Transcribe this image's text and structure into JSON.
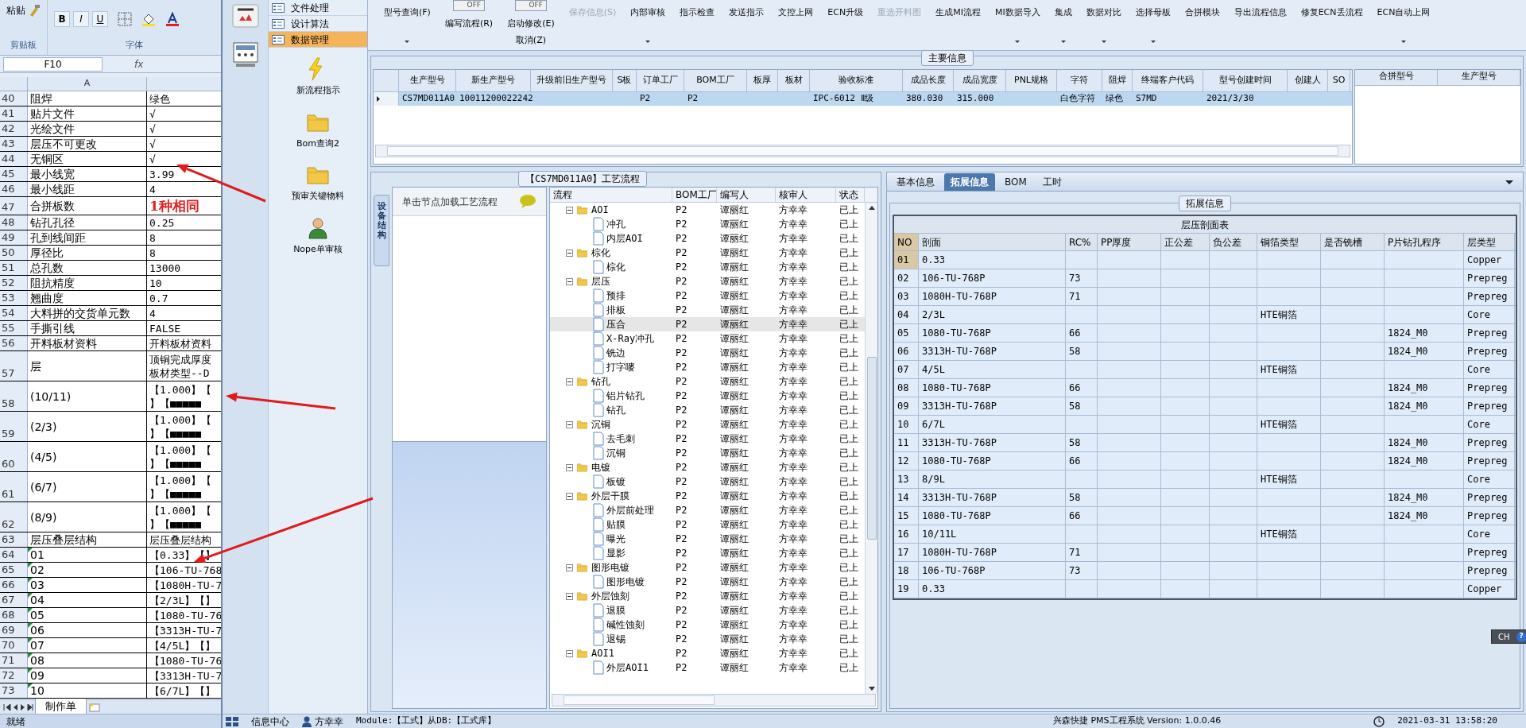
{
  "excel": {
    "ribbon": {
      "paste": "粘贴",
      "clipboard_group": "剪贴板",
      "font_group": "字体",
      "bold": "B",
      "italic": "I",
      "underline": "U"
    },
    "name_box": "F10",
    "fx": "fx",
    "column_a": "A",
    "rows": [
      {
        "row": "40",
        "a": "阻焊",
        "b": [
          "绿色"
        ],
        "kind": "normal"
      },
      {
        "row": "41",
        "a": "贴片文件",
        "b": [
          "√"
        ],
        "kind": "normal"
      },
      {
        "row": "42",
        "a": "光绘文件",
        "b": [
          "√"
        ],
        "kind": "normal"
      },
      {
        "row": "43",
        "a": "层压不可更改",
        "b": [
          "√"
        ],
        "kind": "normal"
      },
      {
        "row": "44",
        "a": "无铜区",
        "b": [
          "√"
        ],
        "kind": "normal"
      },
      {
        "row": "45",
        "a": "最小线宽",
        "b": [
          "3.99"
        ],
        "kind": "normal"
      },
      {
        "row": "46",
        "a": "最小线距",
        "b": [
          "4"
        ],
        "kind": "normal"
      },
      {
        "row": "47",
        "a": "合拼板数",
        "b": [
          "1种相同"
        ],
        "kind": "emphasis"
      },
      {
        "row": "48",
        "a": "钻孔孔径",
        "b": [
          "0.25"
        ],
        "kind": "normal"
      },
      {
        "row": "49",
        "a": "孔到线间距",
        "b": [
          "8"
        ],
        "kind": "normal"
      },
      {
        "row": "50",
        "a": "厚径比",
        "b": [
          "8"
        ],
        "kind": "normal"
      },
      {
        "row": "51",
        "a": "总孔数",
        "b": [
          "13000"
        ],
        "kind": "normal"
      },
      {
        "row": "52",
        "a": "阻抗精度",
        "b": [
          "10"
        ],
        "kind": "normal"
      },
      {
        "row": "53",
        "a": "翘曲度",
        "b": [
          "0.7"
        ],
        "kind": "normal"
      },
      {
        "row": "54",
        "a": "大料拼的交货单元数",
        "b": [
          "4"
        ],
        "kind": "normal"
      },
      {
        "row": "55",
        "a": "手撕引线",
        "b": [
          "FALSE"
        ],
        "kind": "normal"
      },
      {
        "row": "56",
        "a": "开料板材资料",
        "b": [
          "开料板材资料"
        ],
        "kind": "normal"
      },
      {
        "row": "57",
        "a": "层",
        "b": [
          "顶铜完成厚度",
          "板材类型--D"
        ],
        "kind": "double"
      },
      {
        "row": "58",
        "a": "(10/11)",
        "b": [
          "【1.000】【",
          "】【■■■■■"
        ],
        "kind": "double"
      },
      {
        "row": "59",
        "a": "(2/3)",
        "b": [
          "【1.000】【",
          "】【■■■■■"
        ],
        "kind": "double"
      },
      {
        "row": "60",
        "a": "(4/5)",
        "b": [
          "【1.000】【",
          "】【■■■■■"
        ],
        "kind": "double"
      },
      {
        "row": "61",
        "a": "(6/7)",
        "b": [
          "【1.000】【",
          "】【■■■■■"
        ],
        "kind": "double"
      },
      {
        "row": "62",
        "a": "(8/9)",
        "b": [
          "【1.000】【",
          "】【■■■■■"
        ],
        "kind": "double"
      },
      {
        "row": "63",
        "a": "层压叠层结构",
        "b": [
          "层压叠层结构"
        ],
        "kind": "normal"
      },
      {
        "row": "64",
        "a": "01",
        "b": [
          "【0.33】【】"
        ],
        "kind": "flagged"
      },
      {
        "row": "65",
        "a": "02",
        "b": [
          "【106-TU-768"
        ],
        "kind": "flagged"
      },
      {
        "row": "66",
        "a": "03",
        "b": [
          "【1080H-TU-7"
        ],
        "kind": "flagged"
      },
      {
        "row": "67",
        "a": "04",
        "b": [
          "【2/3L】【】"
        ],
        "kind": "flagged"
      },
      {
        "row": "68",
        "a": "05",
        "b": [
          "【1080-TU-76"
        ],
        "kind": "flagged"
      },
      {
        "row": "69",
        "a": "06",
        "b": [
          "【3313H-TU-7"
        ],
        "kind": "flagged"
      },
      {
        "row": "70",
        "a": "07",
        "b": [
          "【4/5L】【】"
        ],
        "kind": "flagged"
      },
      {
        "row": "71",
        "a": "08",
        "b": [
          "【1080-TU-76"
        ],
        "kind": "flagged"
      },
      {
        "row": "72",
        "a": "09",
        "b": [
          "【3313H-TU-7"
        ],
        "kind": "flagged"
      },
      {
        "row": "73",
        "a": "10",
        "b": [
          "【6/7L】【】"
        ],
        "kind": "flagged"
      }
    ],
    "sheet_tabs": [
      {
        "label": "制作单",
        "selected": true
      }
    ],
    "status": "就绪"
  },
  "nav": {
    "items": [
      {
        "label": "文件处理",
        "selected": false
      },
      {
        "label": "设计算法",
        "selected": false
      },
      {
        "label": "数据管理",
        "selected": true
      }
    ],
    "tools": [
      {
        "label": "新流程指示",
        "kind": "lightning"
      },
      {
        "label": "Bom查询2",
        "kind": "folder"
      },
      {
        "label": "预审关键物料",
        "kind": "folder"
      },
      {
        "label": "Nope单审核",
        "kind": "person"
      }
    ]
  },
  "toolbar": [
    {
      "kind": "button",
      "label": "型号查询(F)",
      "dropdown": true,
      "disabled": false
    },
    {
      "kind": "toggle",
      "switch": "OFF",
      "on": false,
      "label": "编写流程(R)"
    },
    {
      "kind": "toggle",
      "switch": "OFF",
      "on": false,
      "label": "启动修改(E)",
      "sub_label": "取消(Z)"
    },
    {
      "kind": "button",
      "label": "保存信息(S)",
      "dropdown": false,
      "disabled": true
    },
    {
      "kind": "button",
      "label": "内部审核",
      "dropdown": true,
      "disabled": false
    },
    {
      "kind": "button",
      "label": "指示检查",
      "dropdown": false,
      "disabled": false
    },
    {
      "kind": "button",
      "label": "发送指示",
      "dropdown": false,
      "disabled": false
    },
    {
      "kind": "button",
      "label": "文控上网",
      "dropdown": false,
      "disabled": false
    },
    {
      "kind": "button",
      "label": "ECN升级",
      "dropdown": false,
      "disabled": false
    },
    {
      "kind": "button",
      "label": "重选开料图",
      "dropdown": false,
      "disabled": true
    },
    {
      "kind": "button",
      "label": "生成MI流程",
      "dropdown": false,
      "disabled": false
    },
    {
      "kind": "button",
      "label": "MI数据导入",
      "dropdown": true,
      "disabled": false
    },
    {
      "kind": "button",
      "label": "集成",
      "dropdown": true,
      "disabled": false
    },
    {
      "kind": "button",
      "label": "数据对比",
      "dropdown": true,
      "disabled": false
    },
    {
      "kind": "button",
      "label": "选择母板",
      "dropdown": true,
      "disabled": false
    },
    {
      "kind": "button",
      "label": "合拼模块",
      "dropdown": false,
      "disabled": false
    },
    {
      "kind": "button",
      "label": "导出流程信息",
      "dropdown": false,
      "disabled": false
    },
    {
      "kind": "button",
      "label": "修复ECN丢流程",
      "dropdown": false,
      "disabled": false
    },
    {
      "kind": "button",
      "label": "ECN自动上网",
      "dropdown": true,
      "disabled": false
    }
  ],
  "main_info": {
    "title": "主要信息",
    "columns": [
      "生产型号",
      "新生产型号",
      "升级前旧生产型号",
      "S板",
      "订单工厂",
      "BOM工厂",
      "板厚",
      "板材",
      "验收标准",
      "成品长度",
      "成品宽度",
      "PNL规格",
      "字符",
      "阻焊",
      "终端客户代码",
      "型号创建时间",
      "创建人",
      "SO"
    ],
    "rows": [
      {
        "selected": true,
        "cells": [
          "CS7MD011A0",
          "10011200022242",
          "",
          "",
          "P2",
          "P2",
          "",
          "",
          "IPC-6012 Ⅱ级",
          "380.030",
          "315.000",
          "",
          "白色字符",
          "绿色",
          "S7MD",
          "2021/3/30",
          "",
          ""
        ]
      }
    ],
    "side_columns": [
      "合拼型号",
      "生产型号"
    ]
  },
  "process": {
    "title": "【CS7MD011A0】工艺流程",
    "side_tab": "设备结构",
    "hint": "单击节点加载工艺流程",
    "columns": [
      "流程",
      "BOM工厂",
      "编写人",
      "核审人",
      "状态"
    ],
    "tree": [
      {
        "name": "AOI",
        "bom": "P2",
        "writer": "谭丽红",
        "reviewer": "方幸幸",
        "status": "已上",
        "expanded": true,
        "selected": false,
        "children": [
          {
            "name": "冲孔",
            "bom": "P2",
            "writer": "谭丽红",
            "reviewer": "方幸幸",
            "status": "已上",
            "selected": false
          },
          {
            "name": "内层AOI",
            "bom": "P2",
            "writer": "谭丽红",
            "reviewer": "方幸幸",
            "status": "已上",
            "selected": false
          }
        ]
      },
      {
        "name": "棕化",
        "bom": "P2",
        "writer": "谭丽红",
        "reviewer": "方幸幸",
        "status": "已上",
        "expanded": true,
        "selected": false,
        "children": [
          {
            "name": "棕化",
            "bom": "P2",
            "writer": "谭丽红",
            "reviewer": "方幸幸",
            "status": "已上",
            "selected": false
          }
        ]
      },
      {
        "name": "层压",
        "bom": "P2",
        "writer": "谭丽红",
        "reviewer": "方幸幸",
        "status": "已上",
        "expanded": true,
        "selected": false,
        "children": [
          {
            "name": "预排",
            "bom": "P2",
            "writer": "谭丽红",
            "reviewer": "方幸幸",
            "status": "已上",
            "selected": false
          },
          {
            "name": "排板",
            "bom": "P2",
            "writer": "谭丽红",
            "reviewer": "方幸幸",
            "status": "已上",
            "selected": false
          },
          {
            "name": "压合",
            "bom": "P2",
            "writer": "谭丽红",
            "reviewer": "方幸幸",
            "status": "已上",
            "selected": true
          },
          {
            "name": "X-Ray冲孔",
            "bom": "P2",
            "writer": "谭丽红",
            "reviewer": "方幸幸",
            "status": "已上",
            "selected": false
          },
          {
            "name": "铣边",
            "bom": "P2",
            "writer": "谭丽红",
            "reviewer": "方幸幸",
            "status": "已上",
            "selected": false
          },
          {
            "name": "打字嘜",
            "bom": "P2",
            "writer": "谭丽红",
            "reviewer": "方幸幸",
            "status": "已上",
            "selected": false
          }
        ]
      },
      {
        "name": "钻孔",
        "bom": "P2",
        "writer": "谭丽红",
        "reviewer": "方幸幸",
        "status": "已上",
        "expanded": true,
        "selected": false,
        "children": [
          {
            "name": "铝片钻孔",
            "bom": "P2",
            "writer": "谭丽红",
            "reviewer": "方幸幸",
            "status": "已上",
            "selected": false
          },
          {
            "name": "钻孔",
            "bom": "P2",
            "writer": "谭丽红",
            "reviewer": "方幸幸",
            "status": "已上",
            "selected": false
          }
        ]
      },
      {
        "name": "沉铜",
        "bom": "P2",
        "writer": "谭丽红",
        "reviewer": "方幸幸",
        "status": "已上",
        "expanded": true,
        "selected": false,
        "children": [
          {
            "name": "去毛刺",
            "bom": "P2",
            "writer": "谭丽红",
            "reviewer": "方幸幸",
            "status": "已上",
            "selected": false
          },
          {
            "name": "沉铜",
            "bom": "P2",
            "writer": "谭丽红",
            "reviewer": "方幸幸",
            "status": "已上",
            "selected": false
          }
        ]
      },
      {
        "name": "电镀",
        "bom": "P2",
        "writer": "谭丽红",
        "reviewer": "方幸幸",
        "status": "已上",
        "expanded": true,
        "selected": false,
        "children": [
          {
            "name": "板镀",
            "bom": "P2",
            "writer": "谭丽红",
            "reviewer": "方幸幸",
            "status": "已上",
            "selected": false
          }
        ]
      },
      {
        "name": "外层干膜",
        "bom": "P2",
        "writer": "谭丽红",
        "reviewer": "方幸幸",
        "status": "已上",
        "expanded": true,
        "selected": false,
        "children": [
          {
            "name": "外层前处理",
            "bom": "P2",
            "writer": "谭丽红",
            "reviewer": "方幸幸",
            "status": "已上",
            "selected": false
          },
          {
            "name": "贴膜",
            "bom": "P2",
            "writer": "谭丽红",
            "reviewer": "方幸幸",
            "status": "已上",
            "selected": false
          },
          {
            "name": "曝光",
            "bom": "P2",
            "writer": "谭丽红",
            "reviewer": "方幸幸",
            "status": "已上",
            "selected": false
          },
          {
            "name": "显影",
            "bom": "P2",
            "writer": "谭丽红",
            "reviewer": "方幸幸",
            "status": "已上",
            "selected": false
          }
        ]
      },
      {
        "name": "图形电镀",
        "bom": "P2",
        "writer": "谭丽红",
        "reviewer": "方幸幸",
        "status": "已上",
        "expanded": true,
        "selected": false,
        "children": [
          {
            "name": "图形电镀",
            "bom": "P2",
            "writer": "谭丽红",
            "reviewer": "方幸幸",
            "status": "已上",
            "selected": false
          }
        ]
      },
      {
        "name": "外层蚀刻",
        "bom": "P2",
        "writer": "谭丽红",
        "reviewer": "方幸幸",
        "status": "已上",
        "expanded": true,
        "selected": false,
        "children": [
          {
            "name": "退膜",
            "bom": "P2",
            "writer": "谭丽红",
            "reviewer": "方幸幸",
            "status": "已上",
            "selected": false
          },
          {
            "name": "碱性蚀刻",
            "bom": "P2",
            "writer": "谭丽红",
            "reviewer": "方幸幸",
            "status": "已上",
            "selected": false
          },
          {
            "name": "退锡",
            "bom": "P2",
            "writer": "谭丽红",
            "reviewer": "方幸幸",
            "status": "已上",
            "selected": false
          }
        ]
      },
      {
        "name": "AOI1",
        "bom": "P2",
        "writer": "谭丽红",
        "reviewer": "方幸幸",
        "status": "已上",
        "expanded": true,
        "selected": false,
        "children": [
          {
            "name": "外层AOI1",
            "bom": "P2",
            "writer": "谭丽红",
            "reviewer": "方幸幸",
            "status": "已上",
            "selected": false
          }
        ]
      }
    ]
  },
  "detail": {
    "tabs": [
      {
        "label": "基本信息",
        "selected": false
      },
      {
        "label": "拓展信息",
        "selected": true
      },
      {
        "label": "BOM",
        "selected": false
      },
      {
        "label": "工时",
        "selected": false
      }
    ],
    "group_title": "拓展信息",
    "table_title": "层压剖面表",
    "columns": [
      "NO",
      "剖面",
      "RC%",
      "PP厚度",
      "正公差",
      "负公差",
      "铜箔类型",
      "是否铣槽",
      "P片钻孔程序",
      "层类型"
    ],
    "rows": [
      {
        "selected": true,
        "cells": [
          "01",
          "0.33",
          "",
          "",
          "",
          "",
          "",
          "",
          "",
          "Copper"
        ]
      },
      {
        "selected": false,
        "cells": [
          "02",
          "106-TU-768P",
          "73",
          "",
          "",
          "",
          "",
          "",
          "",
          "Prepreg"
        ]
      },
      {
        "selected": false,
        "cells": [
          "03",
          "1080H-TU-768P",
          "71",
          "",
          "",
          "",
          "",
          "",
          "",
          "Prepreg"
        ]
      },
      {
        "selected": false,
        "cells": [
          "04",
          "2/3L",
          "",
          "",
          "",
          "",
          "HTE铜箔",
          "",
          "",
          "Core"
        ]
      },
      {
        "selected": false,
        "cells": [
          "05",
          "1080-TU-768P",
          "66",
          "",
          "",
          "",
          "",
          "",
          "1824_M0",
          "Prepreg"
        ]
      },
      {
        "selected": false,
        "cells": [
          "06",
          "3313H-TU-768P",
          "58",
          "",
          "",
          "",
          "",
          "",
          "1824_M0",
          "Prepreg"
        ]
      },
      {
        "selected": false,
        "cells": [
          "07",
          "4/5L",
          "",
          "",
          "",
          "",
          "HTE铜箔",
          "",
          "",
          "Core"
        ]
      },
      {
        "selected": false,
        "cells": [
          "08",
          "1080-TU-768P",
          "66",
          "",
          "",
          "",
          "",
          "",
          "1824_M0",
          "Prepreg"
        ]
      },
      {
        "selected": false,
        "cells": [
          "09",
          "3313H-TU-768P",
          "58",
          "",
          "",
          "",
          "",
          "",
          "1824_M0",
          "Prepreg"
        ]
      },
      {
        "selected": false,
        "cells": [
          "10",
          "6/7L",
          "",
          "",
          "",
          "",
          "HTE铜箔",
          "",
          "",
          "Core"
        ]
      },
      {
        "selected": false,
        "cells": [
          "11",
          "3313H-TU-768P",
          "58",
          "",
          "",
          "",
          "",
          "",
          "1824_M0",
          "Prepreg"
        ]
      },
      {
        "selected": false,
        "cells": [
          "12",
          "1080-TU-768P",
          "66",
          "",
          "",
          "",
          "",
          "",
          "1824_M0",
          "Prepreg"
        ]
      },
      {
        "selected": false,
        "cells": [
          "13",
          "8/9L",
          "",
          "",
          "",
          "",
          "HTE铜箔",
          "",
          "",
          "Core"
        ]
      },
      {
        "selected": false,
        "cells": [
          "14",
          "3313H-TU-768P",
          "58",
          "",
          "",
          "",
          "",
          "",
          "1824_M0",
          "Prepreg"
        ]
      },
      {
        "selected": false,
        "cells": [
          "15",
          "1080-TU-768P",
          "66",
          "",
          "",
          "",
          "",
          "",
          "1824_M0",
          "Prepreg"
        ]
      },
      {
        "selected": false,
        "cells": [
          "16",
          "10/11L",
          "",
          "",
          "",
          "",
          "HTE铜箔",
          "",
          "",
          "Core"
        ]
      },
      {
        "selected": false,
        "cells": [
          "17",
          "1080H-TU-768P",
          "71",
          "",
          "",
          "",
          "",
          "",
          "",
          "Prepreg"
        ]
      },
      {
        "selected": false,
        "cells": [
          "18",
          "106-TU-768P",
          "73",
          "",
          "",
          "",
          "",
          "",
          "",
          "Prepreg"
        ]
      },
      {
        "selected": false,
        "cells": [
          "19",
          "0.33",
          "",
          "",
          "",
          "",
          "",
          "",
          "",
          "Copper"
        ]
      }
    ]
  },
  "ime": {
    "language": "CH",
    "help": "?"
  },
  "status_bar": {
    "info_center": "信息中心",
    "user": "方幸幸",
    "module": "Module:【工式】从DB:【工式库】",
    "system": "兴森快捷 PMS工程系统 Version: 1.0.0.46",
    "time": "2021-03-31 13:58:20"
  }
}
